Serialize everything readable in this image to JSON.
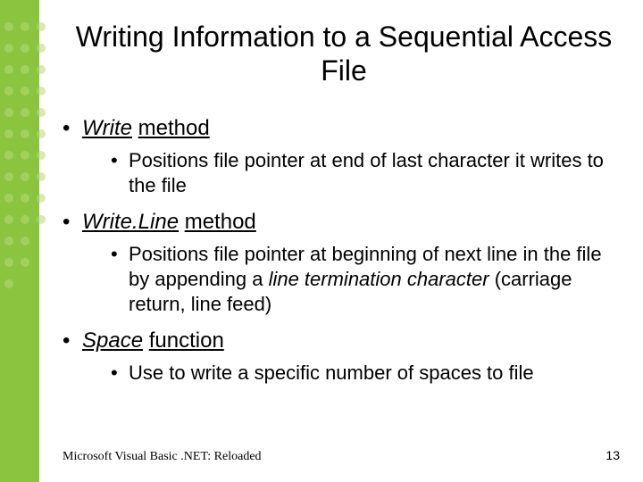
{
  "title": "Writing Information to a Sequential Access File",
  "bullets": [
    {
      "term": "Write",
      "word": "method",
      "sub": [
        {
          "text": "Positions file pointer at end of last character it writes to the file"
        }
      ]
    },
    {
      "term": "Write.Line",
      "word": "method",
      "sub": [
        {
          "pre": "Positions file pointer at beginning of next line in the file by appending a ",
          "ital": "line termination character",
          "post": "  (carriage return, line feed)"
        }
      ]
    },
    {
      "term": "Space",
      "word": "function",
      "sub": [
        {
          "text": "Use to write a specific number of spaces to file"
        }
      ]
    }
  ],
  "footer": "Microsoft Visual Basic .NET: Reloaded",
  "page_number": "13"
}
